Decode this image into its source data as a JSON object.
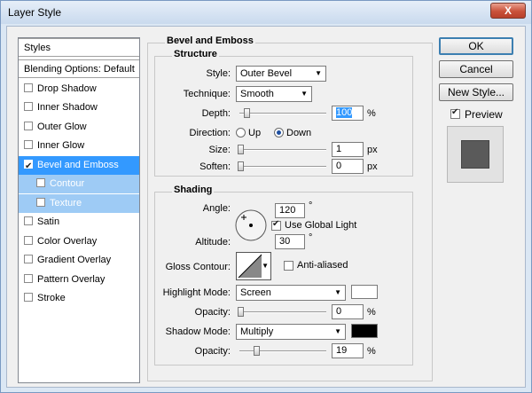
{
  "window": {
    "title": "Layer Style",
    "close_glyph": "X"
  },
  "styles_list": [
    {
      "label": "Styles",
      "kind": "header"
    },
    {
      "label": "Blending Options: Default",
      "kind": "header"
    },
    {
      "label": "Drop Shadow",
      "checked": false
    },
    {
      "label": "Inner Shadow",
      "checked": false
    },
    {
      "label": "Outer Glow",
      "checked": false
    },
    {
      "label": "Inner Glow",
      "checked": false
    },
    {
      "label": "Bevel and Emboss",
      "checked": true,
      "selected": true
    },
    {
      "label": "Contour",
      "checked": false,
      "sub": true
    },
    {
      "label": "Texture",
      "checked": false,
      "sub": true
    },
    {
      "label": "Satin",
      "checked": false
    },
    {
      "label": "Color Overlay",
      "checked": false
    },
    {
      "label": "Gradient Overlay",
      "checked": false
    },
    {
      "label": "Pattern Overlay",
      "checked": false
    },
    {
      "label": "Stroke",
      "checked": false
    }
  ],
  "bevel": {
    "section_title": "Bevel and Emboss",
    "structure_title": "Structure",
    "style_label": "Style:",
    "style_value": "Outer Bevel",
    "technique_label": "Technique:",
    "technique_value": "Smooth",
    "depth_label": "Depth:",
    "depth_value": "100",
    "depth_unit": "%",
    "direction_label": "Direction:",
    "up_label": "Up",
    "down_label": "Down",
    "direction_value": "Down",
    "size_label": "Size:",
    "size_value": "1",
    "size_unit": "px",
    "soften_label": "Soften:",
    "soften_value": "0",
    "soften_unit": "px"
  },
  "shading": {
    "title": "Shading",
    "angle_label": "Angle:",
    "angle_value": "120",
    "angle_unit": "°",
    "global_light_label": "Use Global Light",
    "global_light": true,
    "altitude_label": "Altitude:",
    "altitude_value": "30",
    "altitude_unit": "°",
    "gloss_label": "Gloss Contour:",
    "anti_aliased_label": "Anti-aliased",
    "anti_aliased": false,
    "highlight_label": "Highlight Mode:",
    "highlight_value": "Screen",
    "highlight_color": "#ffffff",
    "hl_opacity_label": "Opacity:",
    "hl_opacity_value": "0",
    "hl_opacity_unit": "%",
    "shadow_label": "Shadow Mode:",
    "shadow_value": "Multiply",
    "shadow_color": "#000000",
    "sh_opacity_label": "Opacity:",
    "sh_opacity_value": "19",
    "sh_opacity_unit": "%"
  },
  "buttons": {
    "ok": "OK",
    "cancel": "Cancel",
    "new_style": "New Style...",
    "preview": "Preview",
    "preview_checked": true
  },
  "colors": {
    "selected_row": "#3399ff",
    "sub_row": "#9ecbf5",
    "preview_swatch": "#5a5a5a"
  }
}
